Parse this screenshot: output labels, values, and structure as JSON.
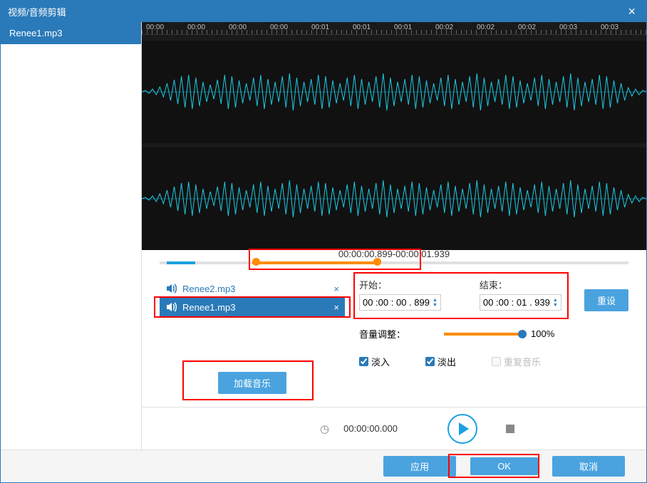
{
  "title": "视频/音频剪辑",
  "sidebar": {
    "file": "Renee1.mp3"
  },
  "ruler": [
    "00:00",
    "00:00",
    "00:00",
    "00:00",
    "00:01",
    "00:01",
    "00:01",
    "00:02",
    "00:02",
    "00:02",
    "00:03",
    "00:03"
  ],
  "range": {
    "label": "00:00:00.899-00:00:01.939"
  },
  "playlist": [
    {
      "name": "Renee2.mp3",
      "selected": false
    },
    {
      "name": "Renee1.mp3",
      "selected": true
    }
  ],
  "controls": {
    "start_label": "开始：",
    "end_label": "结束：",
    "start_value": "00 :00 : 00 . 899",
    "end_value": "00 :00 : 01 . 939",
    "reset": "重设",
    "volume_label": "音量调整：",
    "volume_value": "100%",
    "fade_in": "淡入",
    "fade_out": "淡出",
    "repeat": "重复音乐",
    "load_music": "加载音乐"
  },
  "playbar": {
    "time": "00:00:00.000"
  },
  "footer": {
    "apply": "应用",
    "ok": "OK",
    "cancel": "取消"
  }
}
